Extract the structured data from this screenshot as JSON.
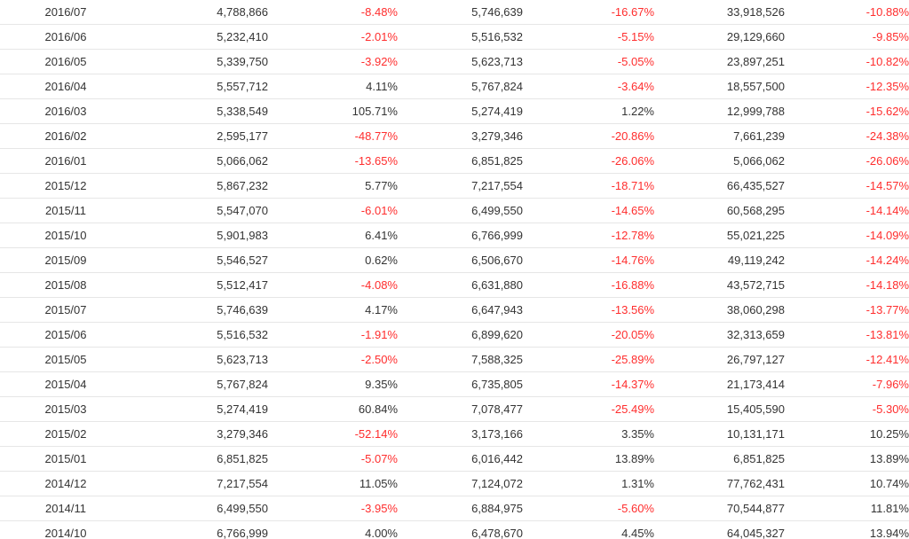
{
  "colors": {
    "negative": "#ff2d2d",
    "text": "#333333",
    "row_border": "#e6e6e6"
  },
  "rows": [
    [
      "2016/07",
      "4,788,866",
      "-8.48%",
      "5,746,639",
      "-16.67%",
      "33,918,526",
      "-10.88%"
    ],
    [
      "2016/06",
      "5,232,410",
      "-2.01%",
      "5,516,532",
      "-5.15%",
      "29,129,660",
      "-9.85%"
    ],
    [
      "2016/05",
      "5,339,750",
      "-3.92%",
      "5,623,713",
      "-5.05%",
      "23,897,251",
      "-10.82%"
    ],
    [
      "2016/04",
      "5,557,712",
      "4.11%",
      "5,767,824",
      "-3.64%",
      "18,557,500",
      "-12.35%"
    ],
    [
      "2016/03",
      "5,338,549",
      "105.71%",
      "5,274,419",
      "1.22%",
      "12,999,788",
      "-15.62%"
    ],
    [
      "2016/02",
      "2,595,177",
      "-48.77%",
      "3,279,346",
      "-20.86%",
      "7,661,239",
      "-24.38%"
    ],
    [
      "2016/01",
      "5,066,062",
      "-13.65%",
      "6,851,825",
      "-26.06%",
      "5,066,062",
      "-26.06%"
    ],
    [
      "2015/12",
      "5,867,232",
      "5.77%",
      "7,217,554",
      "-18.71%",
      "66,435,527",
      "-14.57%"
    ],
    [
      "2015/11",
      "5,547,070",
      "-6.01%",
      "6,499,550",
      "-14.65%",
      "60,568,295",
      "-14.14%"
    ],
    [
      "2015/10",
      "5,901,983",
      "6.41%",
      "6,766,999",
      "-12.78%",
      "55,021,225",
      "-14.09%"
    ],
    [
      "2015/09",
      "5,546,527",
      "0.62%",
      "6,506,670",
      "-14.76%",
      "49,119,242",
      "-14.24%"
    ],
    [
      "2015/08",
      "5,512,417",
      "-4.08%",
      "6,631,880",
      "-16.88%",
      "43,572,715",
      "-14.18%"
    ],
    [
      "2015/07",
      "5,746,639",
      "4.17%",
      "6,647,943",
      "-13.56%",
      "38,060,298",
      "-13.77%"
    ],
    [
      "2015/06",
      "5,516,532",
      "-1.91%",
      "6,899,620",
      "-20.05%",
      "32,313,659",
      "-13.81%"
    ],
    [
      "2015/05",
      "5,623,713",
      "-2.50%",
      "7,588,325",
      "-25.89%",
      "26,797,127",
      "-12.41%"
    ],
    [
      "2015/04",
      "5,767,824",
      "9.35%",
      "6,735,805",
      "-14.37%",
      "21,173,414",
      "-7.96%"
    ],
    [
      "2015/03",
      "5,274,419",
      "60.84%",
      "7,078,477",
      "-25.49%",
      "15,405,590",
      "-5.30%"
    ],
    [
      "2015/02",
      "3,279,346",
      "-52.14%",
      "3,173,166",
      "3.35%",
      "10,131,171",
      "10.25%"
    ],
    [
      "2015/01",
      "6,851,825",
      "-5.07%",
      "6,016,442",
      "13.89%",
      "6,851,825",
      "13.89%"
    ],
    [
      "2014/12",
      "7,217,554",
      "11.05%",
      "7,124,072",
      "1.31%",
      "77,762,431",
      "10.74%"
    ],
    [
      "2014/11",
      "6,499,550",
      "-3.95%",
      "6,884,975",
      "-5.60%",
      "70,544,877",
      "11.81%"
    ],
    [
      "2014/10",
      "6,766,999",
      "4.00%",
      "6,478,670",
      "4.45%",
      "64,045,327",
      "13.94%"
    ]
  ]
}
